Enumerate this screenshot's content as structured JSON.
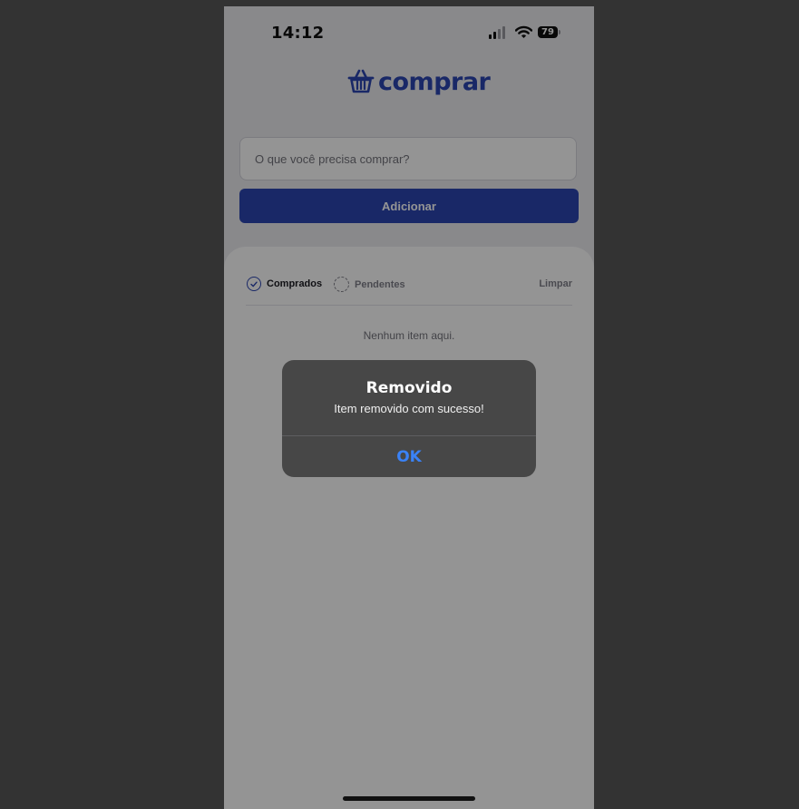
{
  "status_bar": {
    "time": "14:12",
    "battery": "79"
  },
  "app": {
    "logo_text": "comprar"
  },
  "form": {
    "input_placeholder": "O que você precisa comprar?",
    "input_value": "",
    "add_label": "Adicionar"
  },
  "list": {
    "filters": [
      {
        "label": "Comprados",
        "selected": true
      },
      {
        "label": "Pendentes",
        "selected": false
      }
    ],
    "clear_label": "Limpar",
    "empty_message": "Nenhum item aqui."
  },
  "alert": {
    "title": "Removido",
    "message": "Item removido com sucesso!",
    "ok_label": "OK"
  },
  "colors": {
    "brand": "#2c46b1",
    "alert_bg": "#474747",
    "alert_button": "#3a82f7",
    "backdrop": "#333333"
  }
}
